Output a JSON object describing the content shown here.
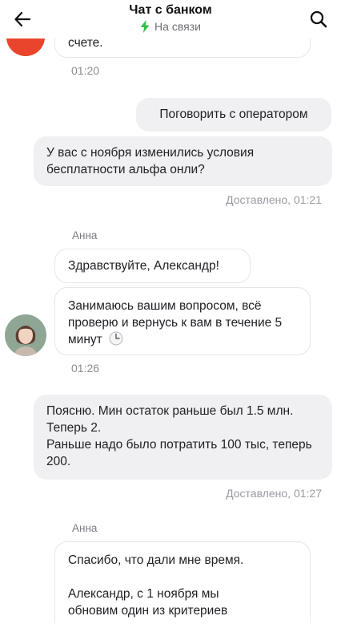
{
  "header": {
    "title": "Чат с банком",
    "status": "На связи",
    "status_color": "#2fbf4a"
  },
  "messages": {
    "top_partial_text": "счете.",
    "time1": "01:20",
    "operator_request": "Поговорить с оператором",
    "question1": "У вас с ноября изменились условия бесплатности альфа онли?",
    "delivered1": "Доставлено, 01:21",
    "author1": "Анна",
    "greeting": "Здравствуйте, Александр!",
    "working": "Занимаюсь вашим вопросом, всё проверю и вернусь к вам в течение 5 минут",
    "time2": "01:26",
    "client_line1": "Поясню. Мин остаток раньше был 1.5 млн. Теперь 2.",
    "client_line2": "Раньше надо было потратить 100 тыс, теперь 200.",
    "delivered2": "Доставлено, 01:27",
    "author2": "Анна",
    "thanks": "Спасибо, что дали мне время.",
    "update": "Александр, с 1 ноября мы обновим один из критериев"
  },
  "icons": {
    "back": "arrow-left-icon",
    "search": "search-icon",
    "status": "lightning-icon",
    "clock": "clock-icon"
  }
}
